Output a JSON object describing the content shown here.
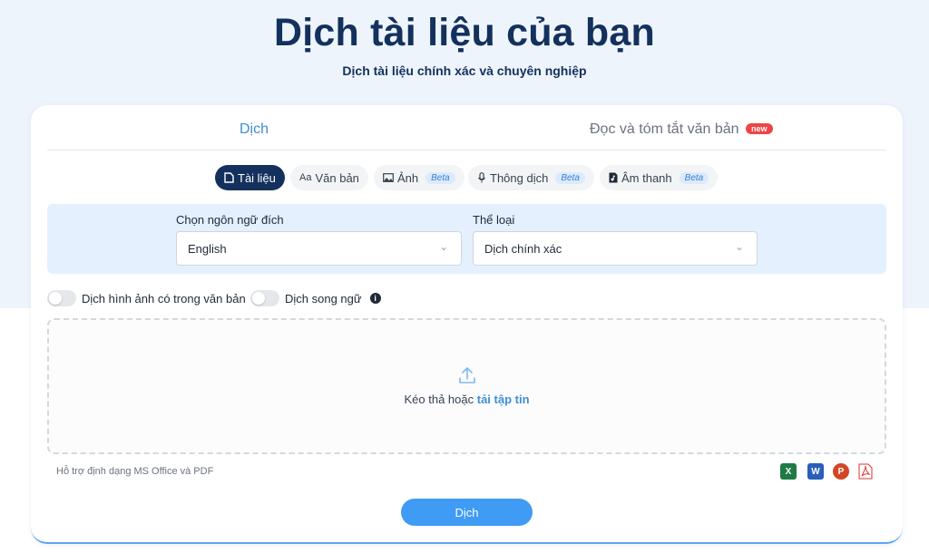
{
  "hero": {
    "title": "Dịch tài liệu của bạn",
    "subtitle": "Dịch tài liệu chính xác và chuyên nghiệp"
  },
  "main_tabs": [
    {
      "label": "Dịch",
      "active": true
    },
    {
      "label": "Đọc và tóm tắt văn bản",
      "badge": "new",
      "active": false
    }
  ],
  "sub_tabs": [
    {
      "label": "Tài liệu",
      "icon": "document-icon",
      "active": true
    },
    {
      "label": "Văn bản",
      "icon_text": "Aa",
      "active": false
    },
    {
      "label": "Ảnh",
      "icon": "image-icon",
      "badge": "Beta",
      "active": false
    },
    {
      "label": "Thông dịch",
      "icon": "microphone-icon",
      "badge": "Beta",
      "active": false
    },
    {
      "label": "Âm thanh",
      "icon": "audio-file-icon",
      "badge": "Beta",
      "active": false
    }
  ],
  "options": {
    "target_language": {
      "label": "Chọn ngôn ngữ đích",
      "value": "English"
    },
    "category": {
      "label": "Thể loại",
      "value": "Dịch chính xác"
    }
  },
  "toggles": [
    {
      "label": "Dịch hình ảnh có trong văn bản",
      "on": false
    },
    {
      "label": "Dịch song ngữ",
      "on": false,
      "has_info": true
    }
  ],
  "dropzone": {
    "text": "Kéo thả hoặc",
    "link": "tải tập tin"
  },
  "support": {
    "text": "Hỗ trợ định dạng MS Office và PDF",
    "formats": [
      "excel-icon",
      "word-icon",
      "powerpoint-icon",
      "pdf-icon"
    ]
  },
  "submit_label": "Dịch",
  "colors": {
    "accent": "#3f9bf4",
    "navy": "#13315c",
    "badge_new": "#ef4444"
  }
}
